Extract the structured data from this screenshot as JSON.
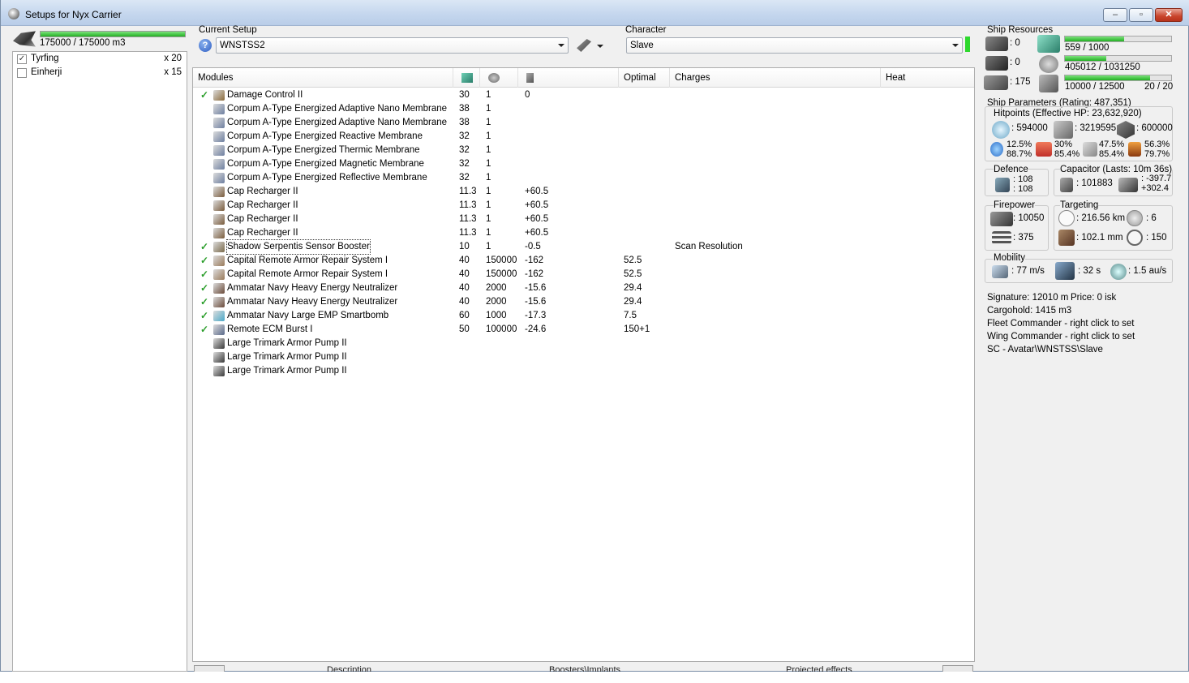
{
  "window": {
    "title": "Setups for Nyx Carrier"
  },
  "volume": {
    "text": "175000 / 175000 m3",
    "fraction": 1.0
  },
  "fighters": [
    {
      "name": "Tyrfing",
      "checked": true,
      "count": "x 20"
    },
    {
      "name": "Einherji",
      "checked": false,
      "count": "x 15"
    }
  ],
  "setup": {
    "label": "Current Setup",
    "value": "WNSTSS2"
  },
  "character": {
    "label": "Character",
    "value": "Slave"
  },
  "modules": {
    "headers": {
      "name": "Modules",
      "optimal": "Optimal",
      "charges": "Charges",
      "heat": "Heat"
    },
    "rows": [
      {
        "active": true,
        "icon": "damage-control-icon",
        "color": "#8a6a3a",
        "name": "Damage Control II",
        "cpu": "30",
        "pg": "1",
        "cap": "0",
        "optimal": "",
        "charges": ""
      },
      {
        "active": false,
        "icon": "armor-membrane-icon",
        "color": "#6e7fa0",
        "name": "Corpum A-Type Energized Adaptive Nano Membrane",
        "cpu": "38",
        "pg": "1",
        "cap": "",
        "optimal": "",
        "charges": ""
      },
      {
        "active": false,
        "icon": "armor-membrane-icon",
        "color": "#6e7fa0",
        "name": "Corpum A-Type Energized Adaptive Nano Membrane",
        "cpu": "38",
        "pg": "1",
        "cap": "",
        "optimal": "",
        "charges": ""
      },
      {
        "active": false,
        "icon": "armor-membrane-icon",
        "color": "#6e7fa0",
        "name": "Corpum A-Type Energized Reactive Membrane",
        "cpu": "32",
        "pg": "1",
        "cap": "",
        "optimal": "",
        "charges": ""
      },
      {
        "active": false,
        "icon": "armor-membrane-icon",
        "color": "#6e7fa0",
        "name": "Corpum A-Type Energized Thermic Membrane",
        "cpu": "32",
        "pg": "1",
        "cap": "",
        "optimal": "",
        "charges": ""
      },
      {
        "active": false,
        "icon": "armor-membrane-icon",
        "color": "#6e7fa0",
        "name": "Corpum A-Type Energized Magnetic Membrane",
        "cpu": "32",
        "pg": "1",
        "cap": "",
        "optimal": "",
        "charges": ""
      },
      {
        "active": false,
        "icon": "armor-membrane-icon",
        "color": "#6e7fa0",
        "name": "Corpum A-Type Energized Reflective Membrane",
        "cpu": "32",
        "pg": "1",
        "cap": "",
        "optimal": "",
        "charges": ""
      },
      {
        "active": false,
        "icon": "cap-recharger-icon",
        "color": "#7a5c3c",
        "name": "Cap Recharger II",
        "cpu": "11.3",
        "pg": "1",
        "cap": "+60.5",
        "optimal": "",
        "charges": ""
      },
      {
        "active": false,
        "icon": "cap-recharger-icon",
        "color": "#7a5c3c",
        "name": "Cap Recharger II",
        "cpu": "11.3",
        "pg": "1",
        "cap": "+60.5",
        "optimal": "",
        "charges": ""
      },
      {
        "active": false,
        "icon": "cap-recharger-icon",
        "color": "#7a5c3c",
        "name": "Cap Recharger II",
        "cpu": "11.3",
        "pg": "1",
        "cap": "+60.5",
        "optimal": "",
        "charges": ""
      },
      {
        "active": false,
        "icon": "cap-recharger-icon",
        "color": "#7a5c3c",
        "name": "Cap Recharger II",
        "cpu": "11.3",
        "pg": "1",
        "cap": "+60.5",
        "optimal": "",
        "charges": ""
      },
      {
        "active": true,
        "icon": "sensor-booster-icon",
        "color": "#7a6a4a",
        "name": "Shadow Serpentis Sensor Booster",
        "cpu": "10",
        "pg": "1",
        "cap": "-0.5",
        "optimal": "",
        "charges": "Scan Resolution",
        "focused": true
      },
      {
        "active": true,
        "icon": "armor-repairer-icon",
        "color": "#9a7a5a",
        "name": "Capital Remote Armor Repair System I",
        "cpu": "40",
        "pg": "150000",
        "cap": "-162",
        "optimal": "52.5",
        "charges": ""
      },
      {
        "active": true,
        "icon": "armor-repairer-icon",
        "color": "#9a7a5a",
        "name": "Capital Remote Armor Repair System I",
        "cpu": "40",
        "pg": "150000",
        "cap": "-162",
        "optimal": "52.5",
        "charges": ""
      },
      {
        "active": true,
        "icon": "energy-neutralizer-icon",
        "color": "#6a4a3a",
        "name": "Ammatar Navy Heavy Energy Neutralizer",
        "cpu": "40",
        "pg": "2000",
        "cap": "-15.6",
        "optimal": "29.4",
        "charges": ""
      },
      {
        "active": true,
        "icon": "energy-neutralizer-icon",
        "color": "#6a4a3a",
        "name": "Ammatar Navy Heavy Energy Neutralizer",
        "cpu": "40",
        "pg": "2000",
        "cap": "-15.6",
        "optimal": "29.4",
        "charges": ""
      },
      {
        "active": true,
        "icon": "smartbomb-icon",
        "color": "#4aa8c8",
        "name": "Ammatar Navy Large EMP Smartbomb",
        "cpu": "60",
        "pg": "1000",
        "cap": "-17.3",
        "optimal": "7.5",
        "charges": ""
      },
      {
        "active": true,
        "icon": "ecm-burst-icon",
        "color": "#5a6a8a",
        "name": "Remote ECM Burst I",
        "cpu": "50",
        "pg": "100000",
        "cap": "-24.6",
        "optimal": "150+1",
        "charges": ""
      },
      {
        "active": false,
        "icon": "armor-pump-rig-icon",
        "color": "#3a3a3a",
        "name": "Large Trimark Armor Pump II",
        "cpu": "",
        "pg": "",
        "cap": "",
        "optimal": "",
        "charges": ""
      },
      {
        "active": false,
        "icon": "armor-pump-rig-icon",
        "color": "#3a3a3a",
        "name": "Large Trimark Armor Pump II",
        "cpu": "",
        "pg": "",
        "cap": "",
        "optimal": "",
        "charges": ""
      },
      {
        "active": false,
        "icon": "armor-pump-rig-icon",
        "color": "#3a3a3a",
        "name": "Large Trimark Armor Pump II",
        "cpu": "",
        "pg": "",
        "cap": "",
        "optimal": "",
        "charges": ""
      }
    ]
  },
  "bottom_tabs": {
    "description": "Description",
    "boosters": "Boosters\\Implants",
    "projected": "Projected effects"
  },
  "resources": {
    "label": "Ship Resources",
    "turrets": ": 0",
    "launchers": ": 0",
    "calibration": ": 175",
    "cpu_text": "559 / 1000",
    "cpu_fraction": 0.559,
    "pg_text": "405012 / 1031250",
    "pg_fraction": 0.393,
    "drone_text": "10000 / 12500",
    "drone_fraction": 0.8,
    "drone_count": "20 / 20"
  },
  "params": {
    "label": "Ship Parameters (Rating: 487,351)",
    "hitpoints_label": "Hitpoints (Effective HP: 23,632,920)",
    "shield_hp": ": 594000",
    "armor_hp": ": 3219595",
    "hull_hp": ": 600000",
    "res_em_top": "12.5%",
    "res_em_bottom": "88.7%",
    "res_therm_top": "30%",
    "res_therm_bottom": "85.4%",
    "res_kin_top": "47.5%",
    "res_kin_bottom": "85.4%",
    "res_exp_top": "56.3%",
    "res_exp_bottom": "79.7%",
    "defence_label": "Defence",
    "def_top": ": 108",
    "def_bottom": ": 108",
    "capacitor_label": "Capacitor (Lasts: 10m 36s)",
    "cap_amount": ": 101883",
    "cap_top": ": -397.7",
    "cap_bottom": "+302.4",
    "firepower_label": "Firepower",
    "fp_top": ": 10050",
    "fp_bottom": ": 375",
    "targeting_label": "Targeting",
    "range": ": 216.56 km",
    "targets": ": 6",
    "scan_res": ": 102.1 mm",
    "sensor": ": 150",
    "mobility_label": "Mobility",
    "speed": ": 77 m/s",
    "align": ": 32 s",
    "warp": ": 1.5 au/s"
  },
  "info": {
    "signature": "Signature: 12010 m",
    "price": "Price: 0 isk",
    "cargohold": "Cargohold: 1415 m3",
    "fleet": "Fleet Commander - right click to set",
    "wing": "Wing Commander - right click to set",
    "sc": "SC - Avatar\\WNSTSS\\Slave"
  }
}
